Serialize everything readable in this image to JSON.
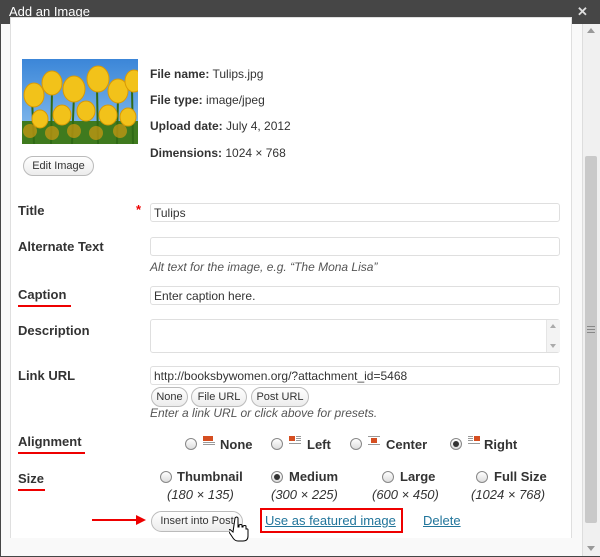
{
  "window": {
    "title": "Add an Image",
    "close_icon": "close-icon"
  },
  "image": {
    "edit_button": "Edit Image",
    "file_name_label": "File name:",
    "file_name": "Tulips.jpg",
    "file_type_label": "File type:",
    "file_type": "image/jpeg",
    "upload_date_label": "Upload date:",
    "upload_date": "July 4, 2012",
    "dimensions_label": "Dimensions:",
    "dimensions": "1024 × 768"
  },
  "form": {
    "title_label": "Title",
    "title_required": "*",
    "title_value": "Tulips",
    "alt_label": "Alternate Text",
    "alt_value": "",
    "alt_help": "Alt text for the image, e.g. “The Mona Lisa”",
    "caption_label": "Caption",
    "caption_value": "Enter caption here.",
    "description_label": "Description",
    "description_value": "",
    "link_label": "Link URL",
    "link_value": "http://booksbywomen.org/?attachment_id=5468",
    "link_presets": [
      "None",
      "File URL",
      "Post URL"
    ],
    "link_help": "Enter a link URL or click above for presets.",
    "alignment_label": "Alignment",
    "alignment_options": [
      {
        "label": "None",
        "checked": false
      },
      {
        "label": "Left",
        "checked": false
      },
      {
        "label": "Center",
        "checked": false
      },
      {
        "label": "Right",
        "checked": true
      }
    ],
    "size_label": "Size",
    "size_options": [
      {
        "label": "Thumbnail",
        "dims": "(180 × 135)",
        "checked": false
      },
      {
        "label": "Medium",
        "dims": "(300 × 225)",
        "checked": true
      },
      {
        "label": "Large",
        "dims": "(600 × 450)",
        "checked": false
      },
      {
        "label": "Full Size",
        "dims": "(1024 × 768)",
        "checked": false
      }
    ]
  },
  "actions": {
    "insert": "Insert into Post",
    "featured": "Use as featured image",
    "delete": "Delete"
  },
  "colors": {
    "annotation_red": "#e00000",
    "link_blue": "#21759b",
    "titlebar": "#464646"
  }
}
